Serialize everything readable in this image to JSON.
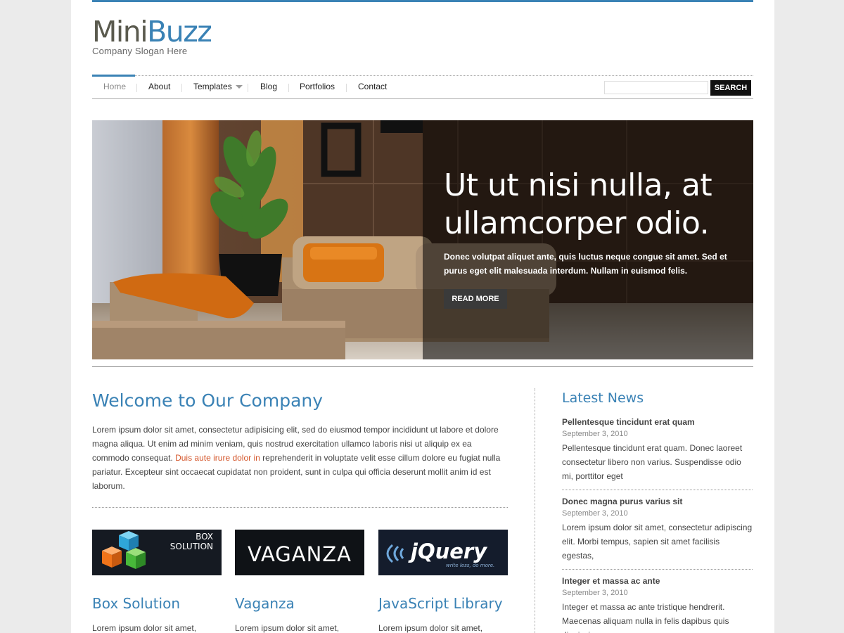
{
  "logo": {
    "part1": "Mini",
    "part2": "Buzz",
    "slogan": "Company Slogan Here"
  },
  "nav": {
    "items": [
      "Home",
      "About",
      "Templates",
      "Blog",
      "Portfolios",
      "Contact"
    ],
    "search_button": "SEARCH",
    "search_value": ""
  },
  "hero": {
    "title": "Ut ut nisi nulla, at ullamcorper odio.",
    "text": "Donec volutpat aliquet ante, quis luctus neque congue sit amet. Sed et purus eget elit malesuada interdum. Nullam in euismod felis.",
    "button": "READ MORE"
  },
  "welcome": {
    "title": "Welcome to Our Company",
    "text_before": "Lorem ipsum dolor sit amet, consectetur adipisicing elit, sed do eiusmod tempor incididunt ut labore et dolore magna aliqua. Ut enim ad minim veniam, quis nostrud exercitation ullamco laboris nisi ut aliquip ex ea commodo consequat. ",
    "link": "Duis aute irure dolor in",
    "text_after": " reprehenderit in voluptate velit esse cillum dolore eu fugiat nulla pariatur. Excepteur sint occaecat cupidatat non proident, sunt in culpa qui officia deserunt mollit anim id est laborum."
  },
  "features": [
    {
      "title": "Box Solution",
      "text": "Lorem ipsum dolor sit amet,",
      "logo_line1": "BOX",
      "logo_line2": "SOLUTION"
    },
    {
      "title": "Vaganza",
      "text": "Lorem ipsum dolor sit amet,",
      "logo_line1": "VAGANZA"
    },
    {
      "title": "JavaScript Library",
      "text": "Lorem ipsum dolor sit amet,",
      "logo_line1": "jQuery",
      "logo_line2": "write less, do more."
    }
  ],
  "news": {
    "heading": "Latest News",
    "items": [
      {
        "title": "Pellentesque tincidunt erat quam",
        "date": "September 3, 2010",
        "excerpt": "Pellentesque tincidunt erat quam. Donec laoreet consectetur libero non varius. Suspendisse odio mi, porttitor eget"
      },
      {
        "title": "Donec magna purus varius sit",
        "date": "September 3, 2010",
        "excerpt": "Lorem ipsum dolor sit amet, consectetur adipiscing elit. Morbi tempus, sapien sit amet facilisis egestas,"
      },
      {
        "title": "Integer et massa ac ante",
        "date": "September 3, 2010",
        "excerpt": "Integer et massa ac ante tristique hendrerit. Maecenas aliquam nulla in felis dapibus quis dignissim"
      }
    ]
  },
  "colors": {
    "accent": "#3a82b5",
    "link": "#d4562b",
    "logo_gray": "#5a5a4e"
  },
  "icons": {
    "nav_dropdown": "chevron-down-icon"
  }
}
